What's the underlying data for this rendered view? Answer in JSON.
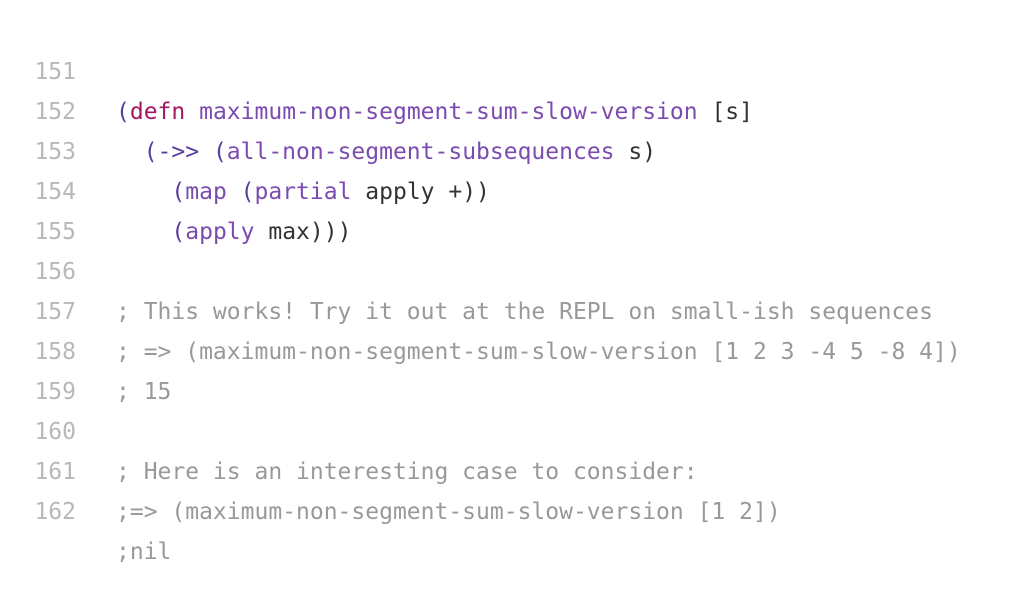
{
  "editor": {
    "colors": {
      "line_number": "#b8b8b8",
      "paren": "#5a3d9c",
      "keyword": "#a7145f",
      "function_name": "#7b4bb0",
      "plain": "#333333",
      "comment": "#999999"
    },
    "lines": [
      {
        "number": "151",
        "tokens": [
          "(",
          "defn",
          " ",
          "maximum-non-segment-sum-slow-version",
          " [s]"
        ]
      },
      {
        "number": "152",
        "tokens": [
          "  (",
          "->>",
          " (",
          "all-non-segment-subsequences",
          " s)"
        ]
      },
      {
        "number": "153",
        "tokens": [
          "    (",
          "map",
          " (",
          "partial",
          " apply +))"
        ]
      },
      {
        "number": "154",
        "tokens": [
          "    (",
          "apply",
          " max)))"
        ]
      },
      {
        "number": "155",
        "tokens": []
      },
      {
        "number": "156",
        "tokens": [
          "; This works! Try it out at the REPL on small-ish sequences"
        ]
      },
      {
        "number": "157",
        "tokens": [
          "; => (maximum-non-segment-sum-slow-version [1 2 3 -4 5 -8 4])"
        ]
      },
      {
        "number": "158",
        "tokens": [
          "; 15"
        ]
      },
      {
        "number": "159",
        "tokens": []
      },
      {
        "number": "160",
        "tokens": [
          "; Here is an interesting case to consider:"
        ]
      },
      {
        "number": "161",
        "tokens": [
          ";=> (maximum-non-segment-sum-slow-version [1 2])"
        ]
      },
      {
        "number": "162",
        "tokens": [
          ";nil"
        ]
      }
    ]
  }
}
